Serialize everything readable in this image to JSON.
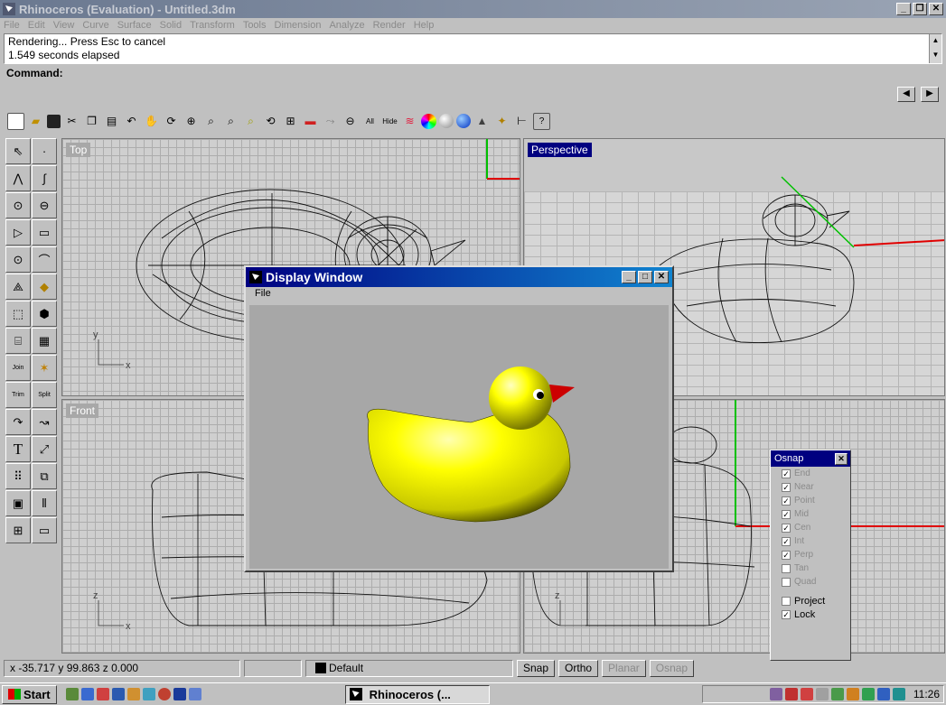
{
  "app": {
    "title": "Rhinoceros (Evaluation) - Untitled.3dm"
  },
  "menu": [
    "File",
    "Edit",
    "View",
    "Curve",
    "Surface",
    "Solid",
    "Transform",
    "Tools",
    "Dimension",
    "Analyze",
    "Render",
    "Help"
  ],
  "status": {
    "line1": "Rendering... Press Esc to cancel",
    "line2": "1.549 seconds elapsed"
  },
  "command": {
    "label": "Command:"
  },
  "toolbar": {
    "all_label": "All",
    "hide_label": "Hide"
  },
  "lefttools": {
    "text_tool": "T",
    "join": "Join",
    "trim": "Trim",
    "split": "Split"
  },
  "viewports": {
    "top": "Top",
    "perspective": "Perspective",
    "front": "Front"
  },
  "axes": {
    "x": "x",
    "y": "y",
    "z": "z"
  },
  "display_window": {
    "title": "Display Window",
    "menu_file": "File"
  },
  "osnap": {
    "title": "Osnap",
    "items": [
      {
        "label": "End",
        "checked": true,
        "enabled": false
      },
      {
        "label": "Near",
        "checked": true,
        "enabled": false
      },
      {
        "label": "Point",
        "checked": true,
        "enabled": false
      },
      {
        "label": "Mid",
        "checked": true,
        "enabled": false
      },
      {
        "label": "Cen",
        "checked": true,
        "enabled": false
      },
      {
        "label": "Int",
        "checked": true,
        "enabled": false
      },
      {
        "label": "Perp",
        "checked": true,
        "enabled": false
      },
      {
        "label": "Tan",
        "checked": false,
        "enabled": false
      },
      {
        "label": "Quad",
        "checked": false,
        "enabled": false
      },
      {
        "label": "Project",
        "checked": false,
        "enabled": true
      },
      {
        "label": "Lock",
        "checked": true,
        "enabled": true
      }
    ]
  },
  "statusbar": {
    "coords": "x -35.717  y 99.863  z 0.000",
    "layer": "Default",
    "snap": "Snap",
    "ortho": "Ortho",
    "planar": "Planar",
    "osnap": "Osnap"
  },
  "taskbar": {
    "start": "Start",
    "task": "Rhinoceros (...",
    "clock": "11:26"
  },
  "colors": {
    "title_active": "#000080",
    "duck_yellow": "#ffff00",
    "beak": "#cc0000"
  }
}
